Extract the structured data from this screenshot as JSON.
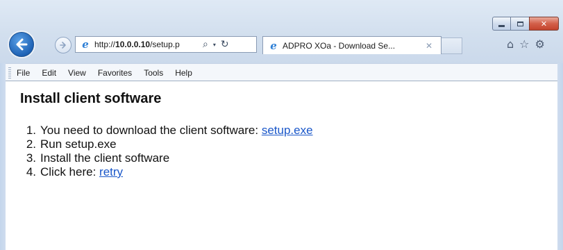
{
  "window": {
    "caption_buttons": {
      "minimize": "minimize",
      "maximize": "maximize",
      "close": "✕"
    }
  },
  "nav": {
    "back_icon": "back-arrow-icon",
    "forward_icon": "forward-arrow-icon",
    "address": {
      "prefix": "http://",
      "host": "10.0.0.10",
      "path": "/setup.p",
      "search_icon": "⌕",
      "dropdown_icon": "▾",
      "refresh_icon": "↻"
    },
    "tab": {
      "title": "ADPRO XOa - Download Se...",
      "close": "✕"
    },
    "toolbar_icons": {
      "home": "⌂",
      "favorites": "☆",
      "tools": "⚙"
    }
  },
  "menu": {
    "items": [
      "File",
      "Edit",
      "View",
      "Favorites",
      "Tools",
      "Help"
    ]
  },
  "page": {
    "heading": "Install client software",
    "steps": [
      {
        "num": "1.",
        "text": "You need to download the client software: ",
        "link": "setup.exe"
      },
      {
        "num": "2.",
        "text": "Run setup.exe"
      },
      {
        "num": "3.",
        "text": "Install the client software"
      },
      {
        "num": "4.",
        "text": "Click here: ",
        "link": "retry"
      }
    ]
  },
  "colors": {
    "link": "#1a57c9",
    "frame": "#d2dfee",
    "close_button": "#c4432d",
    "back_button": "#1e62b5"
  }
}
